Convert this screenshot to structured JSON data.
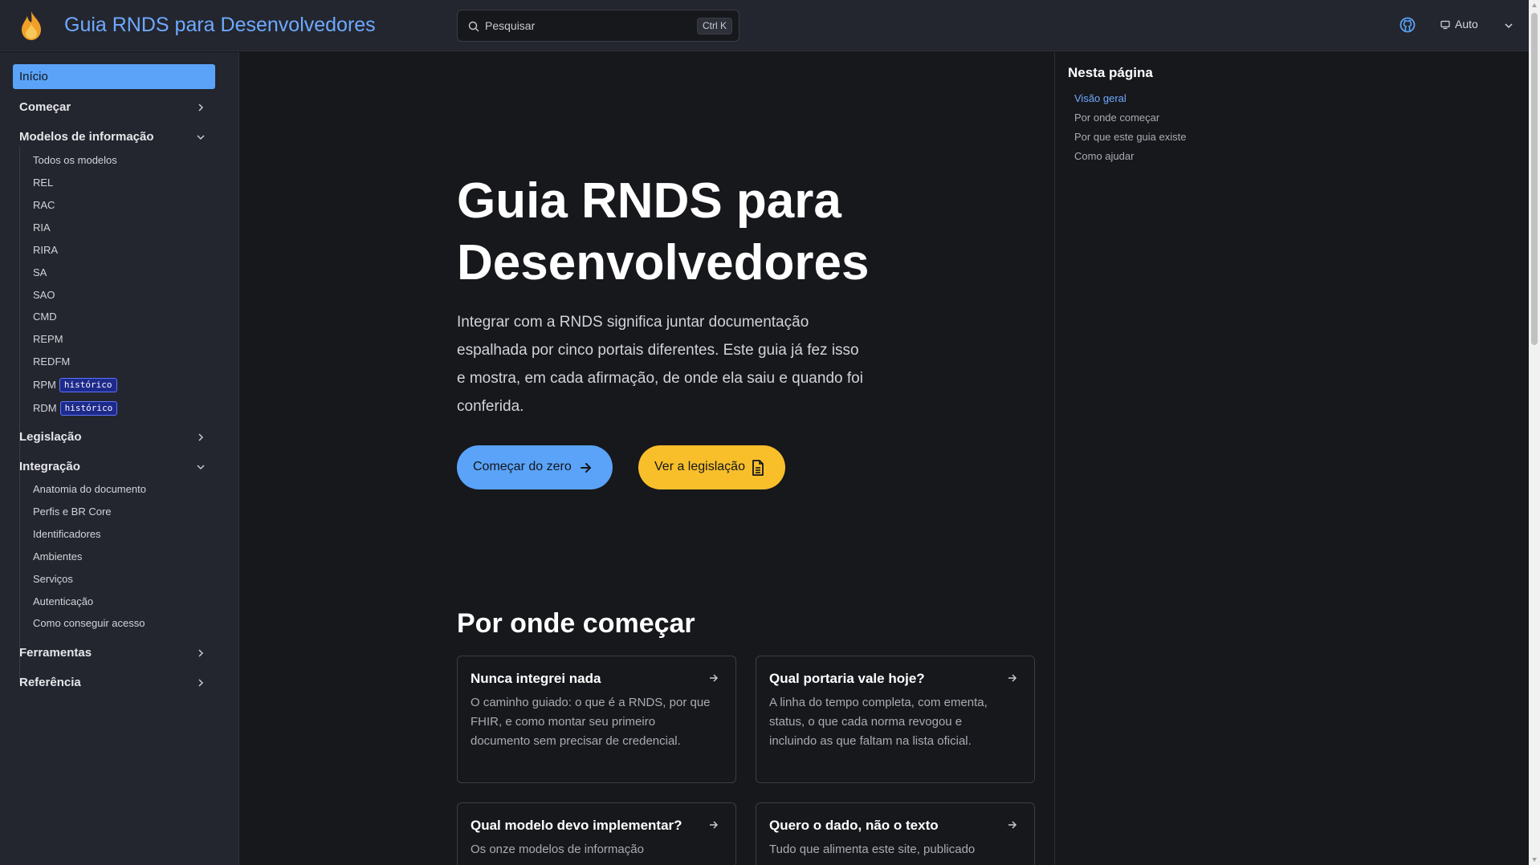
{
  "header": {
    "title": "Guia RNDS para Desenvolvedores",
    "search_placeholder": "Pesquisar",
    "search_shortcut": "Ctrl K",
    "theme_label": "Auto"
  },
  "sidebar": {
    "home": "Início",
    "groups": {
      "comecar": "Começar",
      "modelos": "Modelos de informação",
      "legislacao": "Legislação",
      "integracao": "Integração",
      "ferramentas": "Ferramentas",
      "referencia": "Referência"
    },
    "modelos_items": [
      "Todos os modelos",
      "REL",
      "RAC",
      "RIA",
      "RIRA",
      "SA",
      "SAO",
      "CMD",
      "REPM",
      "REDFM",
      "RPM",
      "RDM"
    ],
    "badge_label": "histórico",
    "integracao_items": [
      "Anatomia do documento",
      "Perfis e BR Core",
      "Identificadores",
      "Ambientes",
      "Serviços",
      "Autenticação",
      "Como conseguir acesso"
    ]
  },
  "main": {
    "hero_title": "Guia RNDS para Desenvolvedores",
    "hero_text": "Integrar com a RNDS significa juntar documentação espalhada por cinco portais diferentes. Este guia já fez isso e mostra, em cada afirmação, de onde ela saiu e quando foi conferida.",
    "btn_primary": "Começar do zero",
    "btn_secondary": "Ver a legislação",
    "section_title": "Por onde começar",
    "cards": [
      {
        "title": "Nunca integrei nada",
        "desc": "O caminho guiado: o que é a RNDS, por que FHIR, e como montar seu primeiro documento sem precisar de credencial."
      },
      {
        "title": "Qual portaria vale hoje?",
        "desc": "A linha do tempo completa, com ementa, status, o que cada norma revogou e incluindo as que faltam na lista oficial."
      },
      {
        "title": "Qual modelo devo implementar?",
        "desc": "Os onze modelos de informação"
      },
      {
        "title": "Quero o dado, não o texto",
        "desc": "Tudo que alimenta este site, publicado"
      }
    ]
  },
  "toc": {
    "title": "Nesta página",
    "items": [
      "Visão geral",
      "Por onde começar",
      "Por que este guia existe",
      "Como ajudar"
    ]
  },
  "colors": {
    "accent": "#5aa3f8",
    "title_link": "#6fa9ff",
    "secondary_button": "#f8bf2b",
    "badge_bg": "#1e2a8a"
  }
}
